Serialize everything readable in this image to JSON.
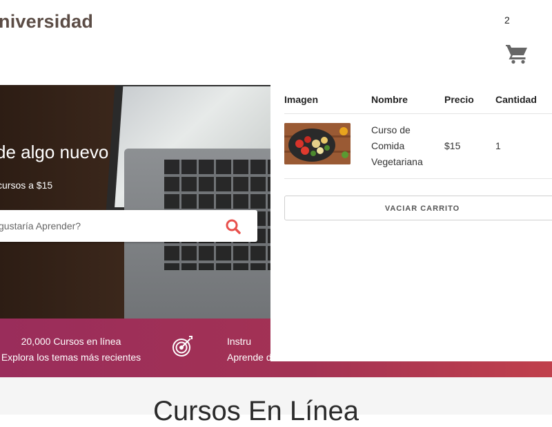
{
  "header": {
    "logo_text": "niversidad",
    "cart_count": "2"
  },
  "hero": {
    "title": "de algo nuevo",
    "subtitle": "cursos a $15",
    "search_placeholder": "gustaría Aprender?"
  },
  "info_bar": {
    "item1_title": "20,000 Cursos en línea",
    "item1_sub": "Explora los temas más recientes",
    "item2_title": "Instru",
    "item2_sub": "Aprende d"
  },
  "section": {
    "title": "Cursos En Línea"
  },
  "cart": {
    "columns": [
      "Imagen",
      "Nombre",
      "Precio",
      "Cantidad"
    ],
    "items": [
      {
        "name_line1": "Curso de",
        "name_line2": "Comida",
        "name_line3": "Vegetariana",
        "price": "$15",
        "quantity": "1"
      }
    ],
    "clear_label": "VACIAR CARRITO"
  },
  "colors": {
    "logo": "#5b4c45",
    "accent": "#e8504c",
    "bar_start": "#9a2d5b",
    "bar_end": "#c0404c"
  },
  "icons": {
    "cart": "shopping-cart-icon",
    "search": "search-icon",
    "target": "target-icon"
  }
}
